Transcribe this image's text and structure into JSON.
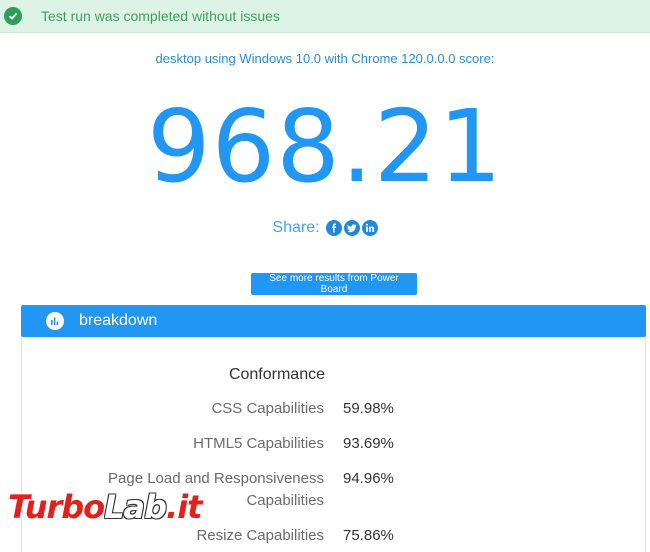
{
  "notice": {
    "text": "Test run was completed without issues",
    "color": "#3f9f63",
    "bg": "#ddf3e5"
  },
  "summary": {
    "subtitle": "desktop using Windows 10.0 with Chrome 120.0.0.0 score:",
    "score": "968.21",
    "share_label": "Share:",
    "share_icons": [
      "facebook-icon",
      "twitter-icon",
      "linkedin-icon"
    ]
  },
  "actions": {
    "more_results_label": "See more results from Power Board"
  },
  "breakdown": {
    "title": "breakdown",
    "section_heading": "Conformance",
    "rows": [
      {
        "label": "CSS Capabilities",
        "value": "59.98%"
      },
      {
        "label": "HTML5 Capabilities",
        "value": "93.69%"
      },
      {
        "label_line1": "Page Load and Responsiveness",
        "label_line2": "Capabilities",
        "value": "94.96%"
      },
      {
        "label": "Resize Capabilities",
        "value": "75.86%"
      }
    ]
  },
  "watermark": {
    "part1": "Turbo",
    "part2": "Lab",
    "part3": ".it"
  },
  "colors": {
    "accent": "#2196f3",
    "success": "#2e9e59"
  }
}
